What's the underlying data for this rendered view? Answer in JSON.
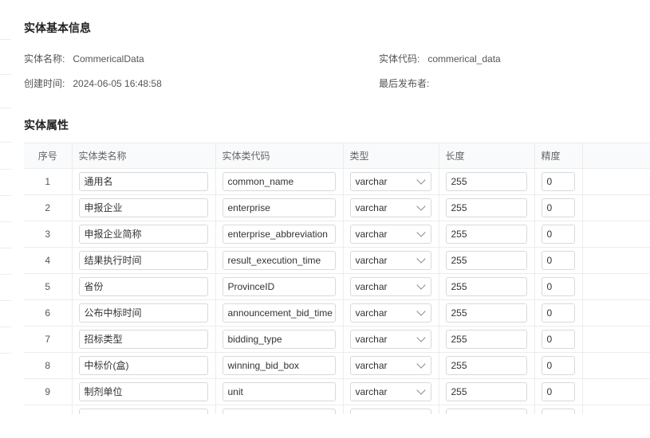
{
  "basic": {
    "title": "实体基本信息",
    "name_label": "实体名称:",
    "name_value": "CommericalData",
    "code_label": "实体代码:",
    "code_value": "commerical_data",
    "created_label": "创建时间:",
    "created_value": "2024-06-05 16:48:58",
    "publisher_label": "最后发布者:",
    "publisher_value": ""
  },
  "attributes": {
    "title": "实体属性",
    "columns": [
      "序号",
      "实体类名称",
      "实体类代码",
      "类型",
      "长度",
      "精度"
    ],
    "rows": [
      {
        "index": "1",
        "name": "通用名",
        "code": "common_name",
        "type": "varchar",
        "length": "255",
        "precision": "0"
      },
      {
        "index": "2",
        "name": "申报企业",
        "code": "enterprise",
        "type": "varchar",
        "length": "255",
        "precision": "0"
      },
      {
        "index": "3",
        "name": "申报企业简称",
        "code": "enterprise_abbreviation",
        "type": "varchar",
        "length": "255",
        "precision": "0"
      },
      {
        "index": "4",
        "name": "结果执行时间",
        "code": "result_execution_time",
        "type": "varchar",
        "length": "255",
        "precision": "0"
      },
      {
        "index": "5",
        "name": "省份",
        "code": "ProvinceID",
        "type": "varchar",
        "length": "255",
        "precision": "0"
      },
      {
        "index": "6",
        "name": "公布中标时间",
        "code": "announcement_bid_time",
        "type": "varchar",
        "length": "255",
        "precision": "0"
      },
      {
        "index": "7",
        "name": "招标类型",
        "code": "bidding_type",
        "type": "varchar",
        "length": "255",
        "precision": "0"
      },
      {
        "index": "8",
        "name": "中标价(盒)",
        "code": "winning_bid_box",
        "type": "varchar",
        "length": "255",
        "precision": "0"
      },
      {
        "index": "9",
        "name": "制剂单位",
        "code": "unit",
        "type": "varchar",
        "length": "255",
        "precision": "0"
      }
    ]
  }
}
